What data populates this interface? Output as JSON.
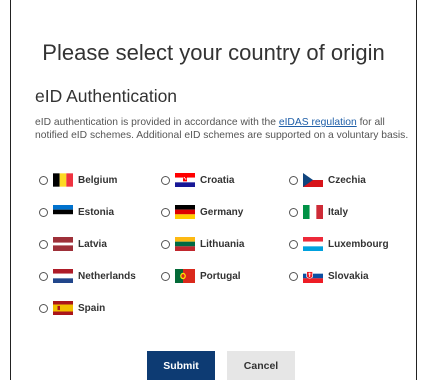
{
  "title": "Please select your country of origin",
  "subtitle": "eID Authentication",
  "description": {
    "before_link": "eID authentication is provided in accordance with the ",
    "link": "eIDAS regulation",
    "after_link": " for all notified eID schemes. Additional eID schemes are supported on a voluntary basis."
  },
  "countries": [
    {
      "label": "Belgium",
      "flag": "belgium-flag"
    },
    {
      "label": "Croatia",
      "flag": "croatia-flag"
    },
    {
      "label": "Czechia",
      "flag": "czechia-flag"
    },
    {
      "label": "Estonia",
      "flag": "estonia-flag"
    },
    {
      "label": "Germany",
      "flag": "germany-flag"
    },
    {
      "label": "Italy",
      "flag": "italy-flag"
    },
    {
      "label": "Latvia",
      "flag": "latvia-flag"
    },
    {
      "label": "Lithuania",
      "flag": "lithuania-flag"
    },
    {
      "label": "Luxembourg",
      "flag": "luxembourg-flag"
    },
    {
      "label": "Netherlands",
      "flag": "netherlands-flag"
    },
    {
      "label": "Portugal",
      "flag": "portugal-flag"
    },
    {
      "label": "Slovakia",
      "flag": "slovakia-flag"
    },
    {
      "label": "Spain",
      "flag": "spain-flag"
    }
  ],
  "buttons": {
    "submit": "Submit",
    "cancel": "Cancel"
  },
  "colors": {
    "submit_bg": "#0d3b73",
    "cancel_bg": "#e6e6e6",
    "link": "#1f5fa8"
  }
}
